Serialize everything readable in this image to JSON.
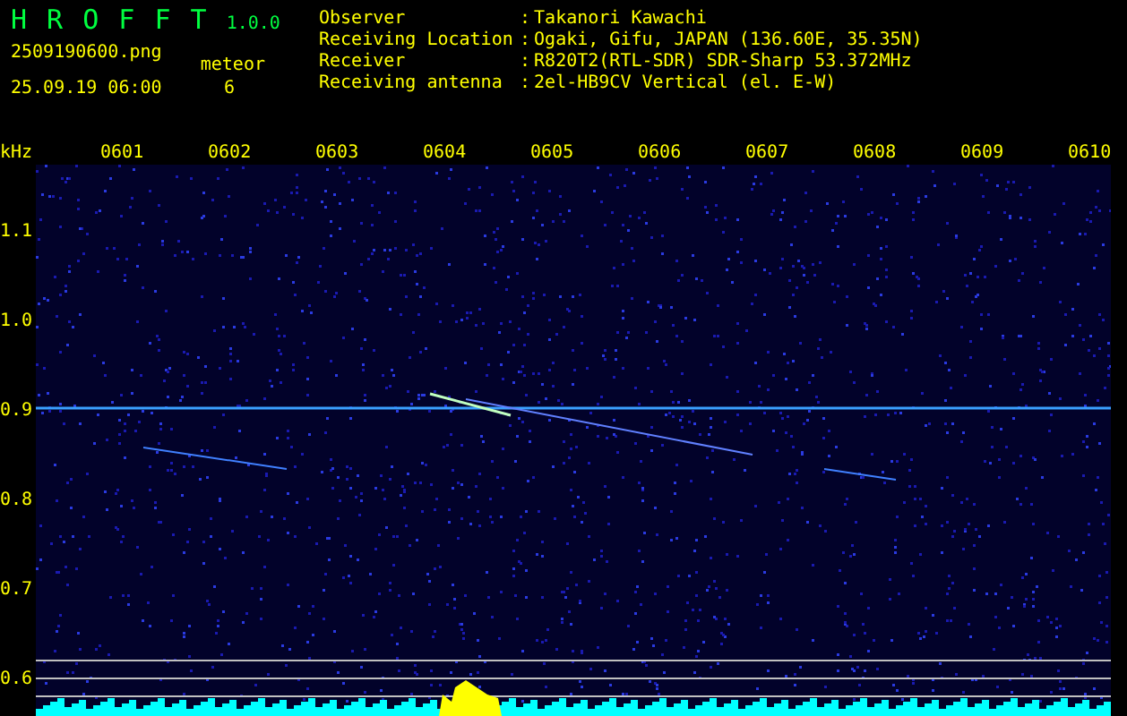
{
  "app": {
    "title": "H R O F F T",
    "version": "1.0.0"
  },
  "file": {
    "name": "2509190600.png",
    "datetime": "25.09.19 06:00"
  },
  "meteor": {
    "label": "meteor",
    "count": "6"
  },
  "info": [
    {
      "label": "Observer",
      "separator": ":",
      "value": "Takanori Kawachi"
    },
    {
      "label": "Receiving Location",
      "separator": ":",
      "value": "Ogaki, Gifu, JAPAN (136.60E, 35.35N)"
    },
    {
      "label": "Receiver",
      "separator": ":",
      "value": "R820T2(RTL-SDR) SDR-Sharp 53.372MHz"
    },
    {
      "label": "Receiving antenna",
      "separator": ":",
      "value": "2el-HB9CV Vertical (el. E-W)"
    }
  ],
  "axis": {
    "unit": "kHz",
    "x_labels": [
      "0601",
      "0602",
      "0603",
      "0604",
      "0605",
      "0606",
      "0607",
      "0608",
      "0609",
      "0610"
    ],
    "y_labels": [
      "1.1",
      "1.0",
      "0.9",
      "0.8",
      "0.7",
      "0.6"
    ]
  }
}
